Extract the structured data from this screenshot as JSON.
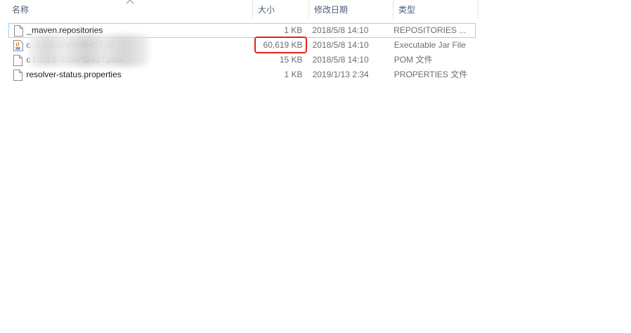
{
  "columns": {
    "name": "名称",
    "size": "大小",
    "date": "修改日期",
    "type": "类型"
  },
  "files": [
    {
      "name": "_maven.repositories",
      "size": "1 KB",
      "date": "2018/5/8 14:10",
      "type": "REPOSITORIES ...",
      "icon": "file-icon",
      "selected": true
    },
    {
      "name": "c                              -0.0.5-SNAPSHOT.jar",
      "size": "60,619 KB",
      "date": "2018/5/8 14:10",
      "type": "Executable Jar File",
      "icon": "java-jar-icon",
      "selected": false
    },
    {
      "name": "c                              t-0.0.5-SNAPSHOT.pom",
      "size": "15 KB",
      "date": "2018/5/8 14:10",
      "type": "POM 文件",
      "icon": "file-icon",
      "selected": false
    },
    {
      "name": "resolver-status.properties",
      "size": "1 KB",
      "date": "2019/1/13 2:34",
      "type": "PROPERTIES 文件",
      "icon": "file-icon",
      "selected": false
    }
  ],
  "colors": {
    "header_text": "#4c607a",
    "selection_border": "#99d1ff",
    "highlight": "#e2231a"
  }
}
